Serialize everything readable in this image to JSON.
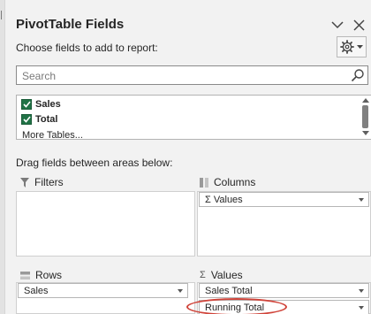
{
  "header": {
    "title": "PivotTable Fields",
    "choose_label": "Choose fields to add to report:"
  },
  "search": {
    "placeholder": "Search"
  },
  "fields": {
    "items": [
      {
        "label": "Sales",
        "checked": true
      },
      {
        "label": "Total",
        "checked": true
      }
    ],
    "more_tables": "More Tables..."
  },
  "areas": {
    "drag_instruction": "Drag fields between areas below:",
    "filters": {
      "label": "Filters"
    },
    "columns": {
      "label": "Columns",
      "items": [
        "Σ Values"
      ]
    },
    "rows": {
      "label": "Rows",
      "items": [
        "Sales"
      ]
    },
    "values": {
      "label": "Values",
      "items": [
        "Sales Total",
        "Running Total"
      ]
    }
  },
  "colors": {
    "checkbox_green": "#217346",
    "annotation_red": "#d0443a"
  },
  "icons": [
    "chevron-down-icon",
    "close-icon",
    "gear-icon",
    "search-icon",
    "funnel-icon",
    "columns-icon",
    "rows-icon",
    "sigma-icon"
  ]
}
